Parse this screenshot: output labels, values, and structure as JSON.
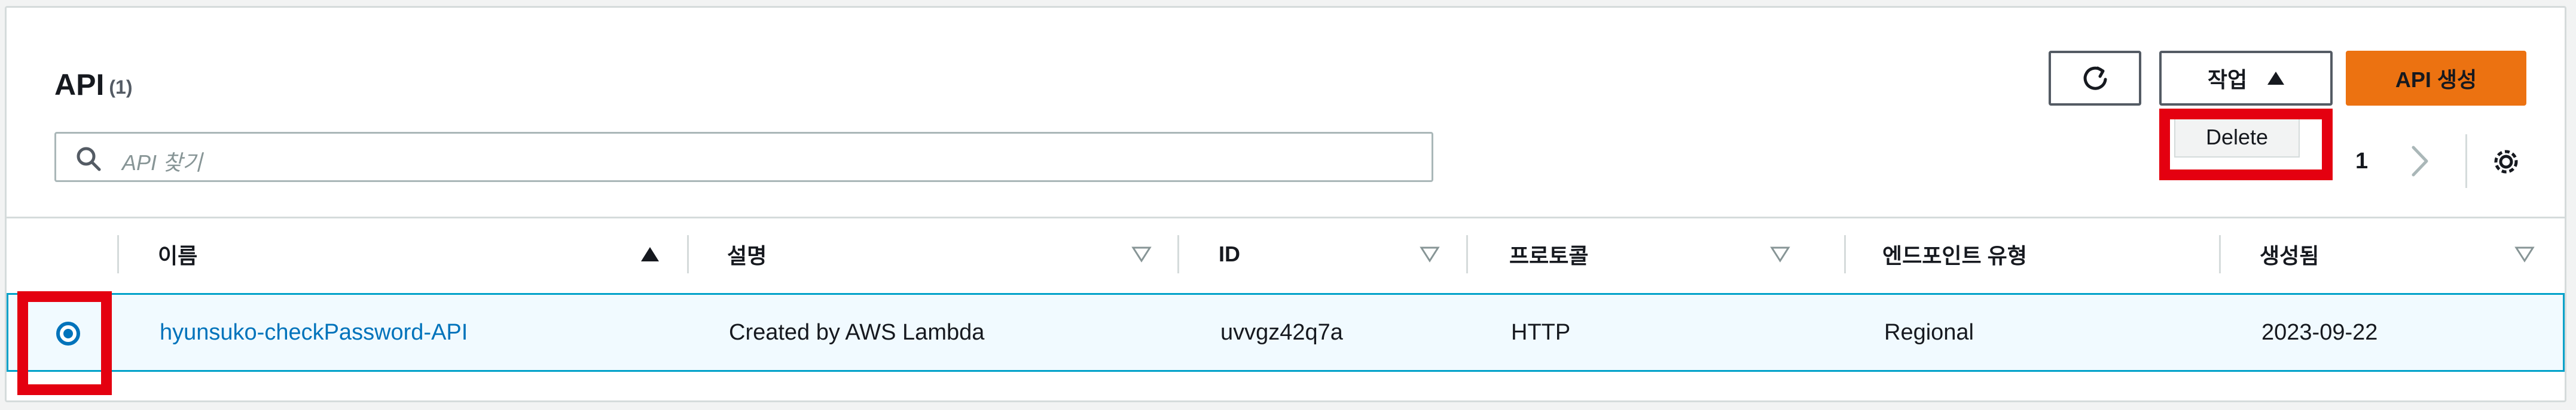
{
  "header": {
    "title": "API",
    "count": "(1)",
    "search_placeholder": "API 찾기",
    "actions_label": "작업",
    "create_label": "API 생성",
    "dropdown": {
      "delete_label": "Delete"
    },
    "pagination": {
      "current_page": "1"
    }
  },
  "table": {
    "columns": [
      "이름",
      "설명",
      "ID",
      "프로토콜",
      "엔드포인트 유형",
      "생성됨"
    ],
    "rows": [
      {
        "name": "hyunsuko-checkPassword-API",
        "description": "Created by AWS Lambda",
        "id": "uvvgz42q7a",
        "protocol": "HTTP",
        "endpoint_type": "Regional",
        "created": "2023-09-22",
        "selected": true
      }
    ]
  },
  "colors": {
    "accent": "#ec7211",
    "link": "#0073bb",
    "selected_row_bg": "#f1faff",
    "selected_row_border": "#00a1c9",
    "highlight": "#e40010"
  },
  "icons": [
    "refresh-icon",
    "caret-up-icon",
    "search-icon",
    "chevron-right-icon",
    "settings-icon",
    "sort-ascending-icon",
    "sort-descending-icon",
    "radio-selected-icon"
  ]
}
